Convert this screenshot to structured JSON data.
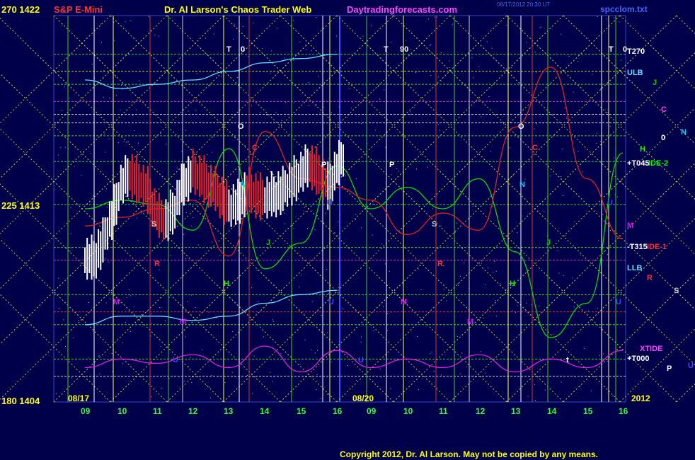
{
  "header": {
    "left_price": "270 1422",
    "symbol": "S&P E-Mini",
    "title": "Dr. Al Larson's Chaos Trader Web",
    "site": "Daytradingforecasts.com",
    "timestamp": "08/17/2012 20:30 UT",
    "filename": "spcclom.txt"
  },
  "footer": {
    "copyright": "Copyright 2012, Dr. Al Larson. May not be copied by any means."
  },
  "axes": {
    "y_labels": [
      {
        "text": "270 1422",
        "price": 1422
      },
      {
        "text": "225 1413",
        "price": 1413
      },
      {
        "text": "180 1404",
        "price": 1404
      }
    ],
    "date_labels": [
      "08/17",
      "08/20",
      "2012"
    ],
    "hour_labels_day1": [
      "09",
      "10",
      "11",
      "12",
      "13",
      "14",
      "15",
      "16"
    ],
    "hour_labels_day2": [
      "09",
      "10",
      "11",
      "12",
      "13",
      "14",
      "15",
      "16"
    ]
  },
  "right_labels": [
    {
      "text": "T270",
      "color": "#ffffff"
    },
    {
      "text": "ULB",
      "color": "#66ddff"
    },
    {
      "text": "J",
      "color": "#00cc00"
    },
    {
      "text": "C",
      "color": "#ff44ff"
    },
    {
      "text": "N",
      "color": "#00ccff"
    },
    {
      "text": "0",
      "color": "#ffffff"
    },
    {
      "text": "H",
      "color": "#00ff00"
    },
    {
      "text": "+T045",
      "color": "#ffffff"
    },
    {
      "text": "IDE-2",
      "color": "#00ff00"
    },
    {
      "text": "M",
      "color": "#ff00ff"
    },
    {
      "text": "-T315",
      "color": "#ffffff"
    },
    {
      "text": "IDE-1",
      "color": "#ff3333"
    },
    {
      "text": "LLB",
      "color": "#66ddff"
    },
    {
      "text": "R",
      "color": "#ff3333"
    },
    {
      "text": "S",
      "color": "#cccccc"
    },
    {
      "text": "XTIDE",
      "color": "#ff44ff"
    },
    {
      "text": "+T000",
      "color": "#ffffff"
    },
    {
      "text": "P",
      "color": "#ffffff"
    },
    {
      "text": "U",
      "color": "#4444ff"
    }
  ],
  "chart_markers": [
    {
      "text": "T",
      "color": "#ffffff"
    },
    {
      "text": "0",
      "color": "#ffffff"
    },
    {
      "text": "T",
      "color": "#ffffff"
    },
    {
      "text": "90",
      "color": "#ffffff"
    },
    {
      "text": "T",
      "color": "#ffffff"
    },
    {
      "text": "0",
      "color": "#ffffff"
    },
    {
      "text": "O",
      "color": "#ffffff"
    },
    {
      "text": "O",
      "color": "#ffffff"
    },
    {
      "text": "C",
      "color": "#ff3333"
    },
    {
      "text": "C",
      "color": "#ff3333"
    },
    {
      "text": "P",
      "color": "#ffffff"
    },
    {
      "text": "P",
      "color": "#ffffff"
    },
    {
      "text": "N",
      "color": "#00ccff"
    },
    {
      "text": "N",
      "color": "#00ccff"
    },
    {
      "text": "S",
      "color": "#cccccc"
    },
    {
      "text": "S",
      "color": "#cccccc"
    },
    {
      "text": "R",
      "color": "#ff3333"
    },
    {
      "text": "R",
      "color": "#ff3333"
    },
    {
      "text": "J",
      "color": "#00cc00"
    },
    {
      "text": "J",
      "color": "#00cc00"
    },
    {
      "text": "H",
      "color": "#00ff00"
    },
    {
      "text": "H",
      "color": "#00ff00"
    },
    {
      "text": "M",
      "color": "#ff00ff"
    },
    {
      "text": "M",
      "color": "#ff00ff"
    },
    {
      "text": "M",
      "color": "#ff00ff"
    },
    {
      "text": "M",
      "color": "#ff00ff"
    },
    {
      "text": "U",
      "color": "#4444ff"
    },
    {
      "text": "U",
      "color": "#4444ff"
    },
    {
      "text": "U",
      "color": "#4444ff"
    },
    {
      "text": "U",
      "color": "#4444ff"
    },
    {
      "text": "U",
      "color": "#4444ff"
    },
    {
      "text": "U",
      "color": "#4444ff"
    },
    {
      "text": "t",
      "color": "#ffffff"
    },
    {
      "text": "t",
      "color": "#ffffff"
    },
    {
      "text": "t",
      "color": "#ffffff"
    }
  ],
  "chart_data": {
    "type": "line",
    "ylim": [
      1404,
      1422
    ],
    "series": [
      {
        "name": "S&P E-Mini",
        "style": "bars",
        "color": "#ffffff",
        "x": [
          9.0,
          9.25,
          9.5,
          9.75,
          10.0,
          10.25,
          10.5,
          10.75,
          11.0,
          11.25,
          11.5,
          11.75,
          12.0,
          12.25,
          12.5,
          12.75,
          13.0,
          13.25,
          13.5,
          13.75,
          14.0,
          14.25,
          14.5,
          14.75,
          15.0,
          15.25,
          15.5,
          15.75,
          16.0
        ],
        "values": [
          1410.6,
          1411.4,
          1412.6,
          1414.0,
          1414.6,
          1414.2,
          1413.8,
          1412.6,
          1412.4,
          1413.0,
          1414.2,
          1414.6,
          1414.4,
          1414.0,
          1413.6,
          1413.0,
          1413.2,
          1413.8,
          1413.6,
          1413.4,
          1413.6,
          1413.8,
          1414.2,
          1414.6,
          1415.0,
          1414.6,
          1414.0,
          1414.8,
          1415.6
        ]
      },
      {
        "name": "ULB",
        "color": "#66ddff",
        "x": [
          9.0,
          10.0,
          11.0,
          12.0,
          13.0,
          14.0,
          15.0,
          16.0
        ],
        "values": [
          1419.0,
          1418.6,
          1418.8,
          1419.0,
          1419.4,
          1419.8,
          1420.0,
          1420.2
        ]
      },
      {
        "name": "LLB",
        "color": "#66ddff",
        "x": [
          9.0,
          10.0,
          11.0,
          12.0,
          13.0,
          14.0,
          15.0,
          16.0
        ],
        "values": [
          1407.6,
          1408.0,
          1408.0,
          1407.8,
          1408.0,
          1408.6,
          1409.0,
          1409.2
        ]
      },
      {
        "name": "IDE-2",
        "color": "#00dd00",
        "x": [
          9.0,
          10.0,
          11.0,
          12.0,
          13.0,
          14.0,
          15.0,
          16.0,
          17.0,
          18.0,
          19.0,
          20.0,
          21.0,
          22.0,
          23.0,
          24.0
        ],
        "values": [
          1413.0,
          1413.4,
          1413.2,
          1412.0,
          1415.8,
          1410.2,
          1411.4,
          1415.0,
          1413.0,
          1414.0,
          1413.0,
          1414.4,
          1411.0,
          1407.0,
          1408.6,
          1415.6
        ]
      },
      {
        "name": "IDE-1",
        "color": "#dd2222",
        "x": [
          9.0,
          10.0,
          11.0,
          12.0,
          13.0,
          14.0,
          15.0,
          16.0,
          17.0,
          18.0,
          19.0,
          20.0,
          21.0,
          22.0,
          23.0,
          24.0
        ],
        "values": [
          1412.2,
          1412.6,
          1413.0,
          1413.4,
          1410.8,
          1416.6,
          1414.4,
          1414.0,
          1413.4,
          1411.8,
          1412.8,
          1412.0,
          1416.8,
          1419.6,
          1414.4,
          1411.6
        ]
      },
      {
        "name": "XTIDE",
        "color": "#dd22dd",
        "x": [
          9.0,
          10.0,
          11.0,
          12.0,
          13.0,
          14.0,
          15.0,
          16.0,
          17.0,
          18.0,
          19.0,
          20.0,
          21.0,
          22.0,
          23.0,
          24.0
        ],
        "values": [
          1405.6,
          1406.0,
          1405.8,
          1406.2,
          1405.6,
          1406.6,
          1405.4,
          1406.4,
          1405.6,
          1406.0,
          1405.6,
          1406.2,
          1405.4,
          1406.0,
          1405.6,
          1406.4
        ]
      }
    ]
  }
}
